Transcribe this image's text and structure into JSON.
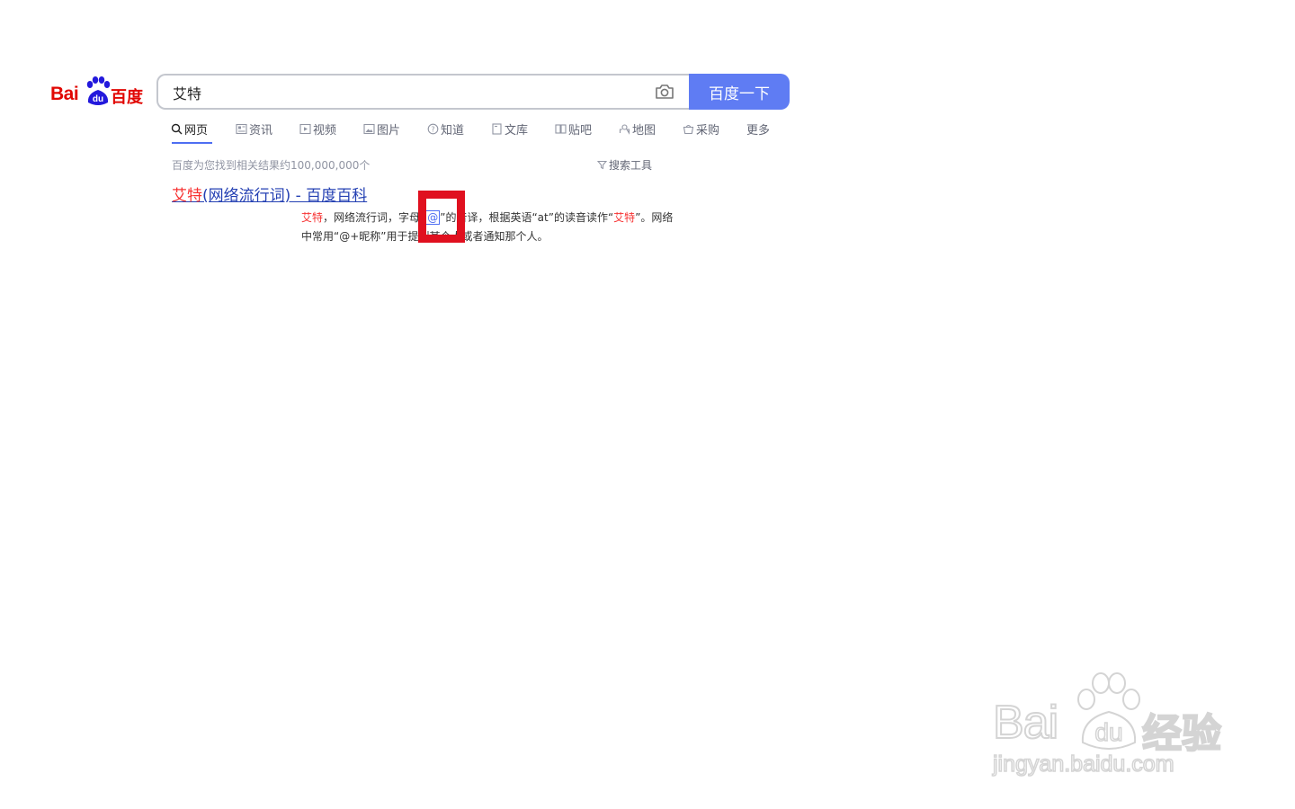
{
  "logo": {
    "text_latin": "Bai",
    "text_du": "du",
    "text_cn": "百度"
  },
  "search": {
    "query": "艾特",
    "button_label": "百度一下"
  },
  "tabs": [
    {
      "label": "网页",
      "icon": "search-icon",
      "active": true
    },
    {
      "label": "资讯",
      "icon": "news-icon"
    },
    {
      "label": "视频",
      "icon": "video-icon"
    },
    {
      "label": "图片",
      "icon": "image-icon"
    },
    {
      "label": "知道",
      "icon": "question-icon"
    },
    {
      "label": "文库",
      "icon": "document-icon"
    },
    {
      "label": "贴吧",
      "icon": "tieba-icon"
    },
    {
      "label": "地图",
      "icon": "map-icon"
    },
    {
      "label": "采购",
      "icon": "basket-icon"
    },
    {
      "label": "更多"
    }
  ],
  "results_summary": "百度为您找到相关结果约100,000,000个",
  "search_tools_label": "搜索工具",
  "result": {
    "title_hl": "艾特",
    "title_rest": "(网络流行词) - 百度百科",
    "abstract": {
      "p1_em": "艾特",
      "p2": "，网络流行词，字母“",
      "at": "@",
      "p3": "”的音译，根据英语“at”的读音读作“",
      "p4_em": "艾特",
      "p5": "”。网络中常用“@+昵称”用于提到某个人或者通知那个人。"
    }
  },
  "watermark": {
    "brand_latin": "Bai",
    "brand_du": "du",
    "brand_cn": "经验",
    "url": "jingyan.baidu.com"
  },
  "colors": {
    "accent": "#4e6ef2",
    "highlight": "#f73131",
    "link": "#2440b3",
    "annotation": "#e0101f"
  }
}
